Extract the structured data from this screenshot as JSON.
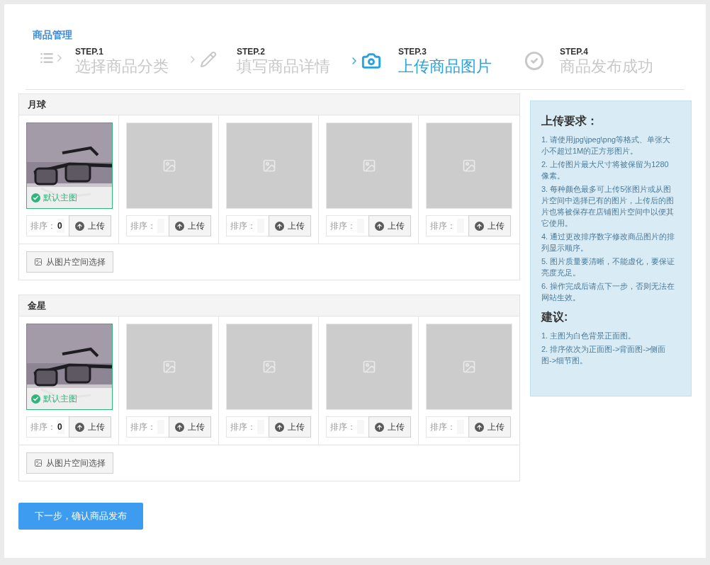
{
  "breadcrumb": "商品管理",
  "steps": [
    {
      "step": "STEP.1",
      "label": "选择商品分类",
      "kind": "list",
      "selected": false
    },
    {
      "step": "STEP.2",
      "label": "填写商品详情",
      "kind": "pencil",
      "selected": false
    },
    {
      "step": "STEP.3",
      "label": "上传商品图片",
      "kind": "camera",
      "selected": true
    },
    {
      "step": "STEP.4",
      "label": "商品发布成功",
      "kind": "check",
      "selected": false
    }
  ],
  "color_groups": [
    {
      "name": "月球",
      "slots": [
        {
          "kind": "picture",
          "main_label": "默认主图",
          "sort_label": "排序：",
          "sort_value": "0",
          "upload_label": "上传"
        },
        {
          "kind": "empty",
          "sort_label": "排序：",
          "upload_label": "上传"
        },
        {
          "kind": "empty",
          "sort_label": "排序：",
          "upload_label": "上传"
        },
        {
          "kind": "empty",
          "sort_label": "排序：",
          "upload_label": "上传"
        },
        {
          "kind": "empty",
          "sort_label": "排序：",
          "upload_label": "上传"
        }
      ],
      "choose_button": "从图片空间选择"
    },
    {
      "name": "金星",
      "slots": [
        {
          "kind": "picture",
          "main_label": "默认主图",
          "sort_label": "排序：",
          "sort_value": "0",
          "upload_label": "上传"
        },
        {
          "kind": "empty",
          "sort_label": "排序：",
          "upload_label": "上传"
        },
        {
          "kind": "empty",
          "sort_label": "排序：",
          "upload_label": "上传"
        },
        {
          "kind": "empty",
          "sort_label": "排序：",
          "upload_label": "上传"
        },
        {
          "kind": "empty",
          "sort_label": "排序：",
          "upload_label": "上传"
        }
      ],
      "choose_button": "从图片空间选择"
    }
  ],
  "requirements": {
    "title": "上传要求：",
    "items": [
      "1. 请使用jpg\\jpeg\\png等格式、单张大小不超过1M的正方形图片。",
      "2. 上传图片最大尺寸将被保留为1280像素。",
      "3. 每种颜色最多可上传5张图片或从图片空间中选择已有的图片，上传后的图片也将被保存在店铺图片空间中以便其它使用。",
      "4. 通过更改排序数字修改商品图片的排列显示顺序。",
      "5. 图片质量要清晰，不能虚化，要保证亮度充足。",
      "6. 操作完成后请点下一步，否则无法在网站生效。"
    ]
  },
  "suggestions": {
    "title": "建议:",
    "items": [
      "1. 主图为白色背景正面图。",
      "2. 排序依次为正面图->背面图->侧面图->细节图。"
    ]
  },
  "next_button": "下一步，确认商品发布"
}
